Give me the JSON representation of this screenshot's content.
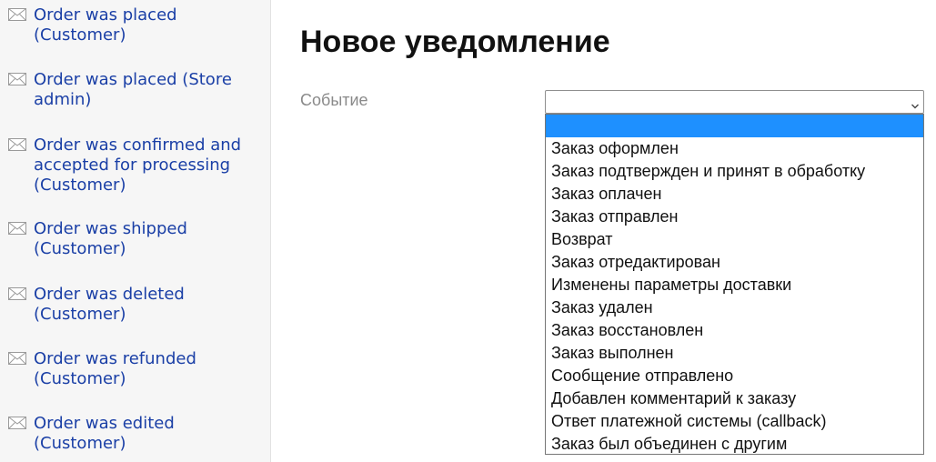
{
  "sidebar": {
    "items": [
      {
        "label": "Order was placed (Customer)"
      },
      {
        "label": "Order was placed (Store admin)"
      },
      {
        "label": "Order was confirmed and accepted for processing (Customer)"
      },
      {
        "label": "Order was shipped (Customer)"
      },
      {
        "label": "Order was deleted (Customer)"
      },
      {
        "label": "Order was refunded (Customer)"
      },
      {
        "label": "Order was edited (Customer)"
      }
    ]
  },
  "main": {
    "title": "Новое уведомление",
    "event_label": "Событие",
    "event_select": {
      "value": "",
      "options": [
        "",
        "Заказ оформлен",
        "Заказ подтвержден и принят в обработку",
        "Заказ оплачен",
        "Заказ отправлен",
        "Возврат",
        "Заказ отредактирован",
        "Изменены параметры доставки",
        "Заказ удален",
        "Заказ восстановлен",
        "Заказ выполнен",
        "Сообщение отправлено",
        "Добавлен комментарий к заказу",
        "Ответ платежной системы (callback)",
        "Заказ был объединен с другим"
      ]
    }
  },
  "colors": {
    "link": "#1a3fa6",
    "selection": "#1e90ff",
    "sidebar_bg": "#f6f6f6"
  }
}
